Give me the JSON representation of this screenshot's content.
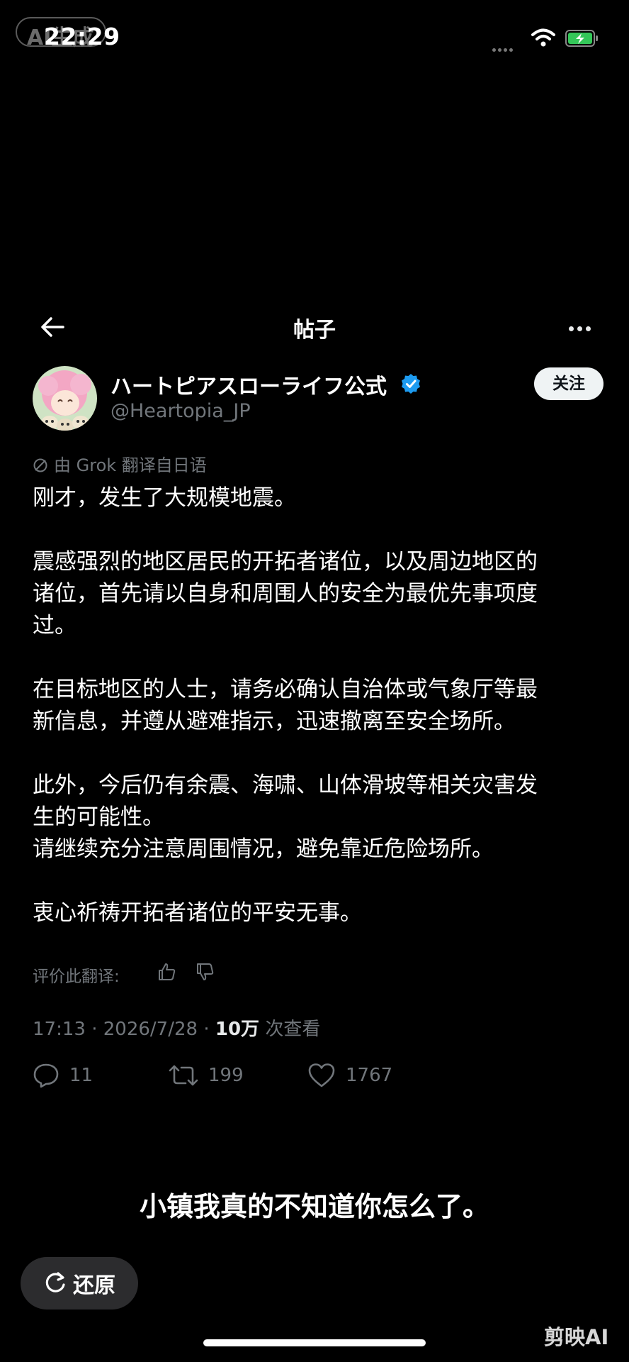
{
  "status_bar": {
    "badge_text": "AI生成",
    "time": "22:29"
  },
  "nav": {
    "title": "帖子",
    "back_icon": "arrow-left-icon",
    "more_icon": "more-horizontal-icon"
  },
  "post": {
    "author": {
      "display_name": "ハートピアスローライフ公式",
      "handle": "@Heartopia_JP",
      "verified": true
    },
    "follow_label": "关注",
    "translation_note": "由 Grok 翻译自日语",
    "paragraphs": [
      [
        "刚才，发生了大规模地震。"
      ],
      [
        "震感强烈的地区居民的开拓者诸位，以及周边地区的",
        "诸位，首先请以自身和周围人的安全为最优先事项度",
        "过。"
      ],
      [
        "在目标地区的人士，请务必确认自治体或气象厅等最",
        "新信息，并遵从避难指示，迅速撤离至安全场所。"
      ],
      [
        "此外，今后仍有余震、海啸、山体滑坡等相关灾害发",
        "生的可能性。",
        "请继续充分注意周围情况，避免靠近危险场所。"
      ],
      [
        "衷心祈祷开拓者诸位的平安无事。"
      ]
    ],
    "rate_label": "评价此翻译:",
    "meta": {
      "time": "17:13",
      "date": "2026/7/28",
      "views": "10万",
      "views_label": "次查看"
    },
    "actions": {
      "replies": "11",
      "reposts": "199",
      "likes": "1767"
    }
  },
  "overlay": {
    "subtitle": "小镇我真的不知道你怎么了。",
    "restore_label": "还原",
    "watermark": "剪映AI"
  },
  "colors": {
    "background": "#000000",
    "text": "#ffffff",
    "secondary_text": "#71767b",
    "verified_blue": "#1d9bf0",
    "battery_green": "#34c759"
  }
}
